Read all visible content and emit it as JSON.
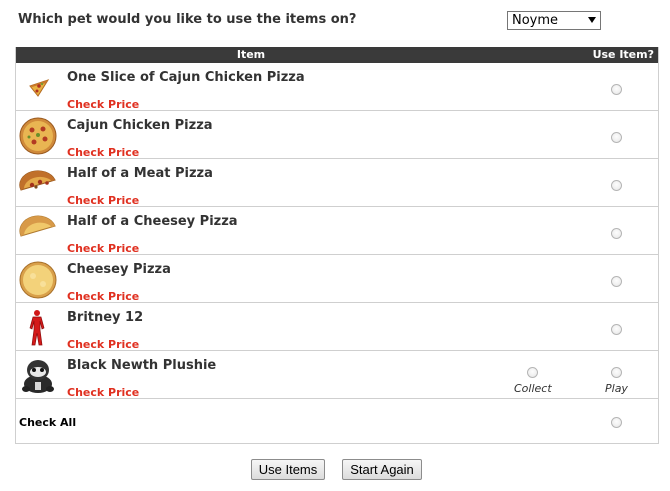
{
  "pet_prompt": "Which pet would you like to use the items on?",
  "pet_select": {
    "value": "Noyme"
  },
  "table": {
    "header_item": "Item",
    "header_use": "Use Item?",
    "check_price_label": "Check Price",
    "items": [
      {
        "name": "One Slice of Cajun Chicken Pizza",
        "icon": "pizza-slice-icon"
      },
      {
        "name": "Cajun Chicken Pizza",
        "icon": "whole-pizza-icon"
      },
      {
        "name": "Half of a Meat Pizza",
        "icon": "half-meat-pizza-icon"
      },
      {
        "name": "Half of a Cheesey Pizza",
        "icon": "half-cheese-pizza-icon"
      },
      {
        "name": "Cheesey Pizza",
        "icon": "cheese-pizza-icon"
      },
      {
        "name": "Britney 12",
        "icon": "red-outfit-icon"
      },
      {
        "name": "Black Newth Plushie",
        "icon": "newth-plushie-icon"
      }
    ],
    "plushie_options": {
      "collect": "Collect",
      "play": "Play"
    },
    "check_all": "Check All"
  },
  "buttons": {
    "use_items": "Use Items",
    "start_again": "Start Again"
  },
  "colors": {
    "header_bg": "#3a3a3a",
    "price_link": "#e03020",
    "row_border": "#cfcfcf"
  }
}
